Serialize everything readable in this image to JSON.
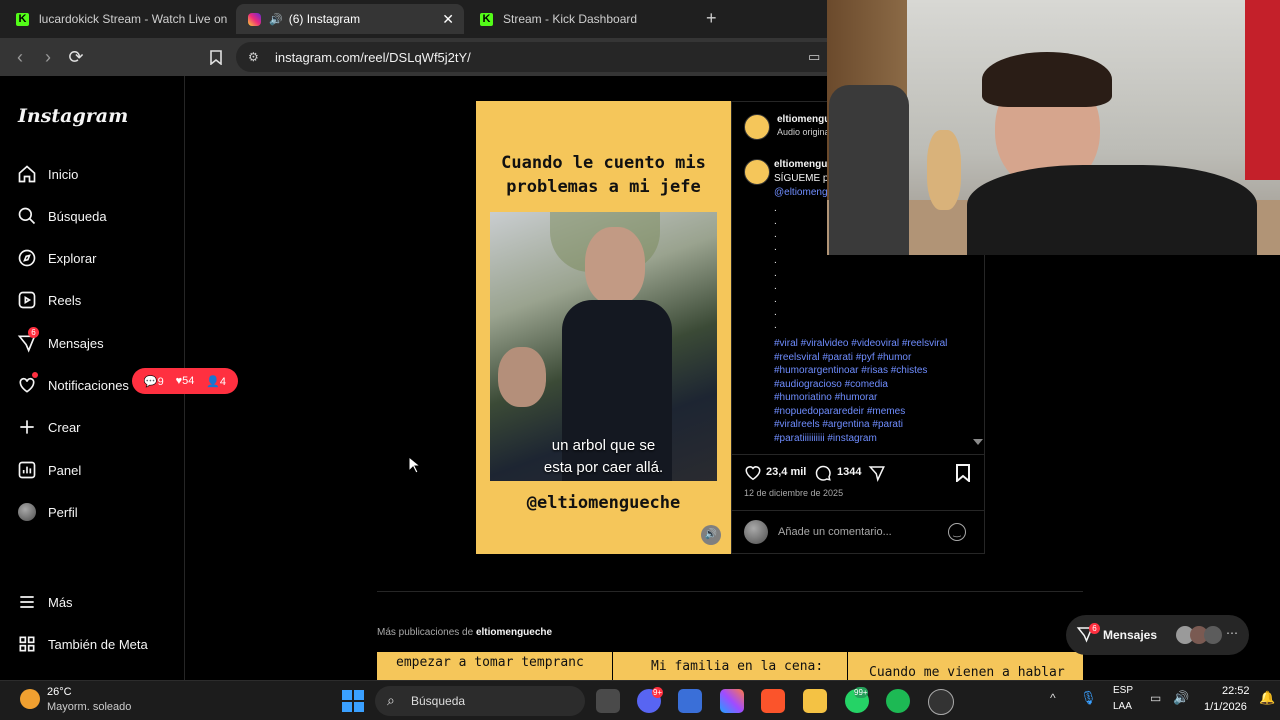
{
  "browser": {
    "tabs": [
      {
        "label": "lucardokick Stream - Watch Live on K"
      },
      {
        "label": "(6) Instagram"
      },
      {
        "label": "Stream - Kick Dashboard"
      }
    ],
    "new_tab": "+",
    "url": "instagram.com/reel/DSLqWf5j2tY/"
  },
  "sidebar": {
    "logo": "Instagram",
    "items": [
      {
        "label": "Inicio",
        "icon": "home-icon"
      },
      {
        "label": "Búsqueda",
        "icon": "search-icon"
      },
      {
        "label": "Explorar",
        "icon": "compass-icon"
      },
      {
        "label": "Reels",
        "icon": "reels-icon"
      },
      {
        "label": "Mensajes",
        "icon": "messenger-icon",
        "badge": "6"
      },
      {
        "label": "Notificaciones",
        "icon": "heart-icon"
      },
      {
        "label": "Crear",
        "icon": "plus-icon"
      },
      {
        "label": "Panel",
        "icon": "chart-icon"
      },
      {
        "label": "Perfil",
        "icon": "avatar"
      }
    ],
    "more": "Más",
    "meta": "También de Meta",
    "notif_pill": {
      "comments": "9",
      "likes": "54",
      "follows": "4"
    }
  },
  "reel": {
    "title_line1": "Cuando le cuento mis",
    "title_line2": "problemas a mi jefe",
    "subtitle_line1": "un arbol que se",
    "subtitle_line2": "esta por caer allá.",
    "handle": "@eltiomengueche"
  },
  "post": {
    "author": "eltiomengueche",
    "audio": "Audio original",
    "caption_author": "eltiomengueche",
    "caption_start": "SÍGUEME p",
    "caption_mention": "@eltiomeng",
    "hashtags": [
      "#viral #viralvideo #videoviral #reelsviral",
      "#reelsviral #parati #pyf #humor",
      "#humorargentinoar #risas #chistes",
      "#audiogracioso #comedia",
      "#humoriatino #humorar",
      "#nopuedopararedeir #memes",
      "#viralreels #argentina #parati",
      "#paratiiiiiiiiii #instagram"
    ],
    "likes": "23,4 mil",
    "comments": "1344",
    "date": "12 de diciembre de 2025",
    "comment_placeholder": "Añade un comentario..."
  },
  "more_posts": {
    "prefix": "Más publicaciones de",
    "author": "eltiomengueche",
    "thumbs": [
      "empezar a tomar tempranc",
      "Mi familia en la cena:",
      "Cuando me vienen a hablar"
    ]
  },
  "messages_float": {
    "label": "Mensajes",
    "badge": "6"
  },
  "taskbar": {
    "weather_temp": "26°C",
    "weather_desc": "Mayorm. soleado",
    "search": "Búsqueda",
    "lang_top": "ESP",
    "lang_bottom": "LAA",
    "time": "22:52",
    "date": "1/1/2026",
    "discord_badge": "9+",
    "whatsapp_badge": "99+"
  },
  "colors": {
    "accent_red": "#ff3040",
    "kick_green": "#53fc18",
    "reel_yellow": "#f5c65a",
    "link_blue": "#6f8dff"
  }
}
